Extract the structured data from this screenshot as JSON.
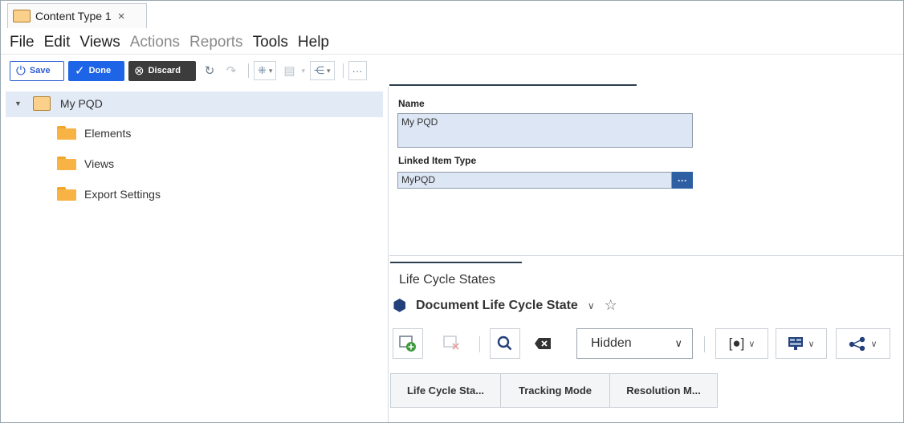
{
  "tab": {
    "label": "Content Type 1",
    "close": "×"
  },
  "menu": {
    "file": "File",
    "edit": "Edit",
    "views": "Views",
    "actions": "Actions",
    "reports": "Reports",
    "tools": "Tools",
    "help": "Help"
  },
  "toolbar": {
    "save": "Save",
    "done": "Done",
    "discard": "Discard",
    "more": "···"
  },
  "tree": {
    "root": "My PQD",
    "children": [
      "Elements",
      "Views",
      "Export Settings"
    ]
  },
  "form": {
    "name_label": "Name",
    "name_value": "My PQD",
    "linked_label": "Linked Item Type",
    "linked_value": "MyPQD",
    "linked_button": "···"
  },
  "lifecycle": {
    "title": "Life Cycle States",
    "document_state": "Document Life Cycle State",
    "visibility_select": "Hidden",
    "columns": [
      "Life Cycle Sta...",
      "Tracking Mode",
      "Resolution M..."
    ]
  },
  "colors": {
    "accent": "#1e64e6",
    "selection": "#e2eaf6",
    "field_bg": "#dce6f4",
    "folder": "#f7b344"
  }
}
